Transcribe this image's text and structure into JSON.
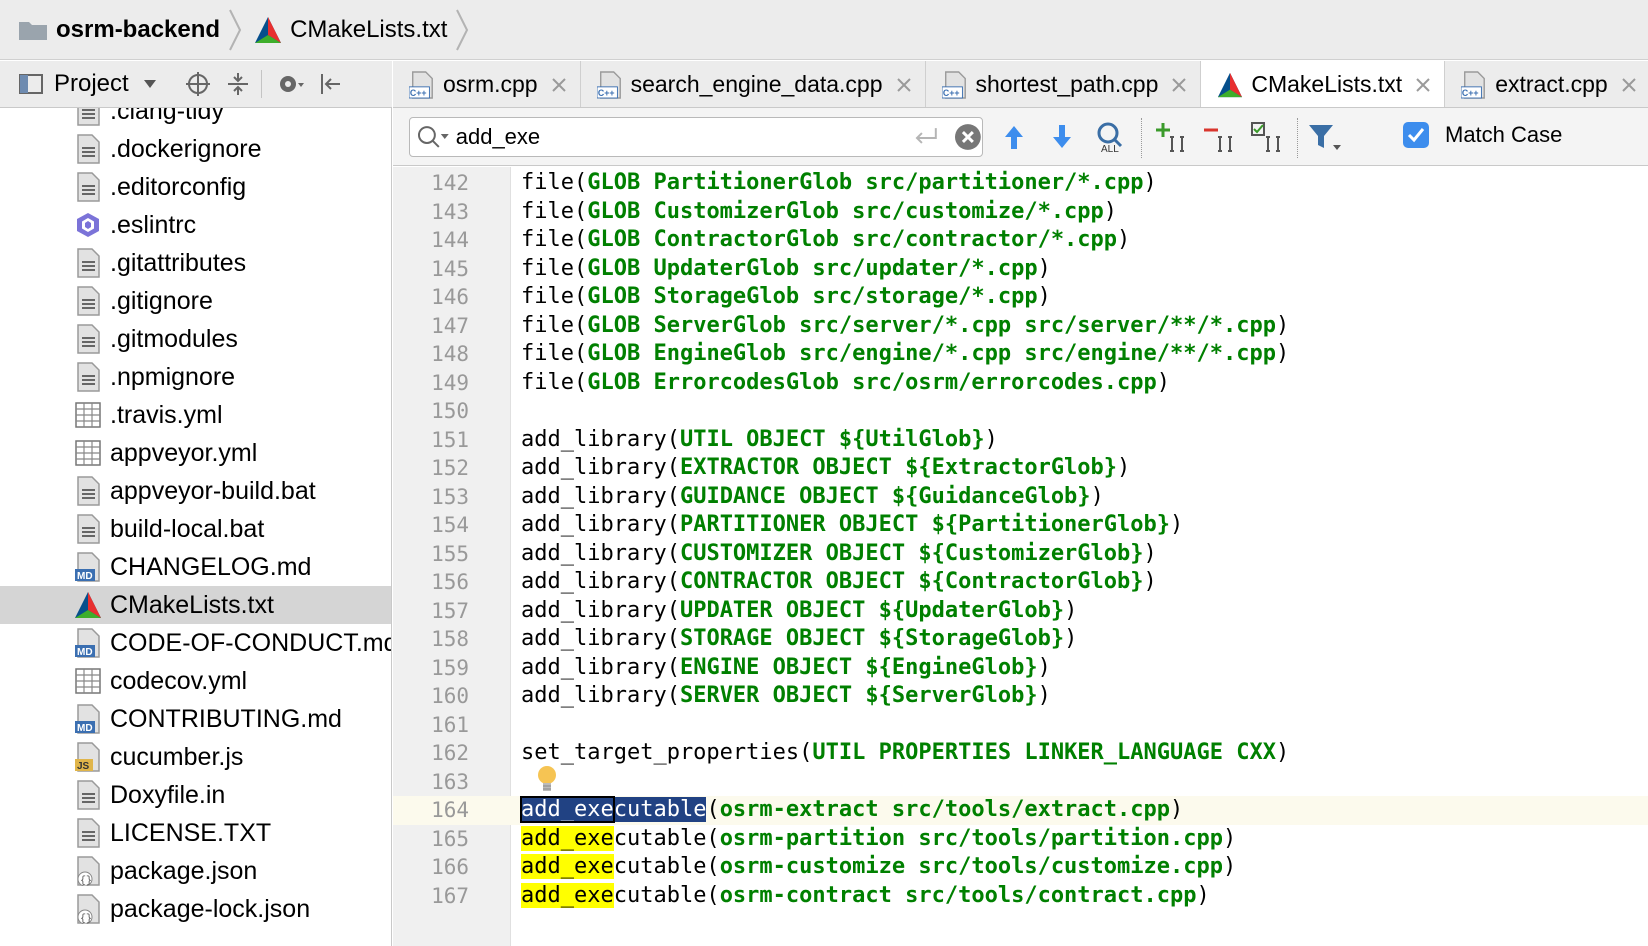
{
  "breadcrumb": {
    "project": "osrm-backend",
    "file": "CMakeLists.txt"
  },
  "project_toolbar": {
    "label": "Project"
  },
  "sidebar": {
    "items": [
      {
        "label": ".clang-tidy",
        "icon": "text-file-icon",
        "partial": true
      },
      {
        "label": ".dockerignore",
        "icon": "text-file-icon"
      },
      {
        "label": ".editorconfig",
        "icon": "text-file-icon"
      },
      {
        "label": ".eslintrc",
        "icon": "eslint-icon"
      },
      {
        "label": ".gitattributes",
        "icon": "text-file-icon"
      },
      {
        "label": ".gitignore",
        "icon": "text-file-icon"
      },
      {
        "label": ".gitmodules",
        "icon": "text-file-icon"
      },
      {
        "label": ".npmignore",
        "icon": "text-file-icon"
      },
      {
        "label": ".travis.yml",
        "icon": "yaml-file-icon"
      },
      {
        "label": "appveyor.yml",
        "icon": "yaml-file-icon"
      },
      {
        "label": "appveyor-build.bat",
        "icon": "text-file-icon"
      },
      {
        "label": "build-local.bat",
        "icon": "text-file-icon"
      },
      {
        "label": "CHANGELOG.md",
        "icon": "markdown-file-icon"
      },
      {
        "label": "CMakeLists.txt",
        "icon": "cmake-icon",
        "selected": true
      },
      {
        "label": "CODE-OF-CONDUCT.md",
        "icon": "markdown-file-icon"
      },
      {
        "label": "codecov.yml",
        "icon": "yaml-file-icon"
      },
      {
        "label": "CONTRIBUTING.md",
        "icon": "markdown-file-icon"
      },
      {
        "label": "cucumber.js",
        "icon": "js-file-icon"
      },
      {
        "label": "Doxyfile.in",
        "icon": "text-file-icon"
      },
      {
        "label": "LICENSE.TXT",
        "icon": "text-file-icon"
      },
      {
        "label": "package.json",
        "icon": "json-file-icon"
      },
      {
        "label": "package-lock.json",
        "icon": "json-file-icon",
        "partial": true
      }
    ]
  },
  "tabs": [
    {
      "label": "osrm.cpp",
      "icon": "cpp-file-icon"
    },
    {
      "label": "search_engine_data.cpp",
      "icon": "cpp-file-icon"
    },
    {
      "label": "shortest_path.cpp",
      "icon": "cpp-file-icon"
    },
    {
      "label": "CMakeLists.txt",
      "icon": "cmake-icon",
      "active": true
    },
    {
      "label": "extract.cpp",
      "icon": "cpp-file-icon"
    }
  ],
  "cpp_badge": "C++",
  "search": {
    "value": "add_exe",
    "match_case_label": "Match Case",
    "match_case_checked": true,
    "all_badge": "ALL"
  },
  "editor": {
    "current_line": 164,
    "lines": [
      {
        "n": "142",
        "segs": [
          {
            "t": "file("
          },
          {
            "t": "GLOB PartitionerGlob src/partitioner/*.cpp",
            "k": "kw"
          },
          {
            "t": ")"
          }
        ]
      },
      {
        "n": "143",
        "segs": [
          {
            "t": "file("
          },
          {
            "t": "GLOB CustomizerGlob src/customize/*.cpp",
            "k": "kw"
          },
          {
            "t": ")"
          }
        ]
      },
      {
        "n": "144",
        "segs": [
          {
            "t": "file("
          },
          {
            "t": "GLOB ContractorGlob src/contractor/*.cpp",
            "k": "kw"
          },
          {
            "t": ")"
          }
        ]
      },
      {
        "n": "145",
        "segs": [
          {
            "t": "file("
          },
          {
            "t": "GLOB UpdaterGlob src/updater/*.cpp",
            "k": "kw"
          },
          {
            "t": ")"
          }
        ]
      },
      {
        "n": "146",
        "segs": [
          {
            "t": "file("
          },
          {
            "t": "GLOB StorageGlob src/storage/*.cpp",
            "k": "kw"
          },
          {
            "t": ")"
          }
        ]
      },
      {
        "n": "147",
        "segs": [
          {
            "t": "file("
          },
          {
            "t": "GLOB ServerGlob src/server/*.cpp src/server/**/*.cpp",
            "k": "kw"
          },
          {
            "t": ")"
          }
        ]
      },
      {
        "n": "148",
        "segs": [
          {
            "t": "file("
          },
          {
            "t": "GLOB EngineGlob src/engine/*.cpp src/engine/**/*.cpp",
            "k": "kw"
          },
          {
            "t": ")"
          }
        ]
      },
      {
        "n": "149",
        "segs": [
          {
            "t": "file("
          },
          {
            "t": "GLOB ErrorcodesGlob src/osrm/errorcodes.cpp",
            "k": "kw"
          },
          {
            "t": ")"
          }
        ]
      },
      {
        "n": "150",
        "segs": []
      },
      {
        "n": "151",
        "segs": [
          {
            "t": "add_library("
          },
          {
            "t": "UTIL OBJECT ${UtilGlob}",
            "k": "kw"
          },
          {
            "t": ")"
          }
        ]
      },
      {
        "n": "152",
        "segs": [
          {
            "t": "add_library("
          },
          {
            "t": "EXTRACTOR OBJECT ${ExtractorGlob}",
            "k": "kw"
          },
          {
            "t": ")"
          }
        ]
      },
      {
        "n": "153",
        "segs": [
          {
            "t": "add_library("
          },
          {
            "t": "GUIDANCE OBJECT ${GuidanceGlob}",
            "k": "kw"
          },
          {
            "t": ")"
          }
        ]
      },
      {
        "n": "154",
        "segs": [
          {
            "t": "add_library("
          },
          {
            "t": "PARTITIONER OBJECT ${PartitionerGlob}",
            "k": "kw"
          },
          {
            "t": ")"
          }
        ]
      },
      {
        "n": "155",
        "segs": [
          {
            "t": "add_library("
          },
          {
            "t": "CUSTOMIZER OBJECT ${CustomizerGlob}",
            "k": "kw"
          },
          {
            "t": ")"
          }
        ]
      },
      {
        "n": "156",
        "segs": [
          {
            "t": "add_library("
          },
          {
            "t": "CONTRACTOR OBJECT ${ContractorGlob}",
            "k": "kw"
          },
          {
            "t": ")"
          }
        ]
      },
      {
        "n": "157",
        "segs": [
          {
            "t": "add_library("
          },
          {
            "t": "UPDATER OBJECT ${UpdaterGlob}",
            "k": "kw"
          },
          {
            "t": ")"
          }
        ]
      },
      {
        "n": "158",
        "segs": [
          {
            "t": "add_library("
          },
          {
            "t": "STORAGE OBJECT ${StorageGlob}",
            "k": "kw"
          },
          {
            "t": ")"
          }
        ]
      },
      {
        "n": "159",
        "segs": [
          {
            "t": "add_library("
          },
          {
            "t": "ENGINE OBJECT ${EngineGlob}",
            "k": "kw"
          },
          {
            "t": ")"
          }
        ]
      },
      {
        "n": "160",
        "segs": [
          {
            "t": "add_library("
          },
          {
            "t": "SERVER OBJECT ${ServerGlob}",
            "k": "kw"
          },
          {
            "t": ")"
          }
        ]
      },
      {
        "n": "161",
        "segs": []
      },
      {
        "n": "162",
        "segs": [
          {
            "t": "set_target_properties("
          },
          {
            "t": "UTIL PROPERTIES LINKER_LANGUAGE CXX",
            "k": "kw"
          },
          {
            "t": ")"
          }
        ]
      },
      {
        "n": "163",
        "segs": []
      },
      {
        "n": "164",
        "segs": [
          {
            "t": "add_exe",
            "k": "sel-box"
          },
          {
            "t": "cutable",
            "k": "sel"
          },
          {
            "t": "("
          },
          {
            "t": "osrm-extract src/tools/extract.cpp",
            "k": "kw"
          },
          {
            "t": ")"
          }
        ]
      },
      {
        "n": "165",
        "segs": [
          {
            "t": "add_exe",
            "k": "hl"
          },
          {
            "t": "cutable("
          },
          {
            "t": "osrm-partition src/tools/partition.cpp",
            "k": "kw"
          },
          {
            "t": ")"
          }
        ]
      },
      {
        "n": "166",
        "segs": [
          {
            "t": "add_exe",
            "k": "hl"
          },
          {
            "t": "cutable("
          },
          {
            "t": "osrm-customize src/tools/customize.cpp",
            "k": "kw"
          },
          {
            "t": ")"
          }
        ]
      },
      {
        "n": "167",
        "segs": [
          {
            "t": "add_exe",
            "k": "hl"
          },
          {
            "t": "cutable("
          },
          {
            "t": "osrm-contract src/tools/contract.cpp",
            "k": "kw"
          },
          {
            "t": ")"
          }
        ]
      }
    ]
  },
  "colors": {
    "keyword": "#008000",
    "search_highlight": "#ffff00",
    "selection": "#214283",
    "checkbox": "#3d8ded",
    "toolbar_arrow": "#3d8ded"
  }
}
